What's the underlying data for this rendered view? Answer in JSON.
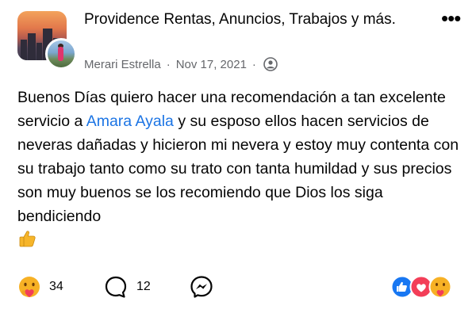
{
  "post": {
    "group_name": "Providence Rentas, Anuncios, Trabajos y más.",
    "author": "Merari Estrella",
    "separator": "·",
    "date": "Nov 17, 2021",
    "privacy_icon": "group-members-icon",
    "more_icon": "more-options-icon",
    "body_part1": "Buenos Días quiero hacer una recomendación a tan excelente servicio a ",
    "mention": "Amara Ayala",
    "body_part2": " y su esposo ellos hacen servicios de neveras dañadas y hicieron mi nevera y estoy muy contenta con su trabajo tanto como su trato con tanta humildad y sus precios son muy buenos se los recomiendo que Dios los siga bendiciendo",
    "trailing_emoji": "thumbs-up-emoji"
  },
  "actions": {
    "reaction_button_icon": "care-reaction-icon",
    "reaction_count": "34",
    "comment_icon": "comment-icon",
    "comment_count": "12",
    "share_icon": "messenger-icon"
  },
  "reactions_summary": [
    "like",
    "love",
    "care"
  ],
  "colors": {
    "mention": "#1b74e4",
    "meta_text": "#65676b",
    "like_blue": "#1877f2",
    "love_red": "#f33e58",
    "care_yellow": "#f7b125"
  }
}
